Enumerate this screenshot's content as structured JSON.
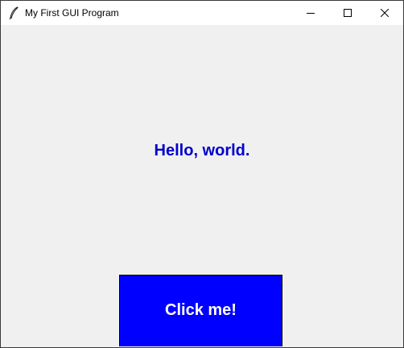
{
  "window": {
    "title": "My First GUI Program",
    "app_icon": "feather-icon",
    "controls": {
      "minimize_icon": "minimize-icon",
      "maximize_icon": "maximize-icon",
      "close_icon": "close-icon"
    }
  },
  "main": {
    "label_text": "Hello, world.",
    "label_color": "#0000cc",
    "button_label": "Click me!",
    "button_color": "#0000ff",
    "button_text_color": "#ffffff",
    "background_color": "#f0f0f0"
  }
}
